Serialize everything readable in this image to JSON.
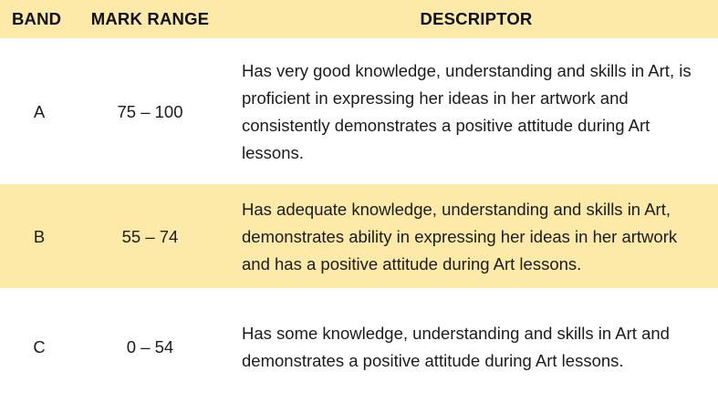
{
  "headers": {
    "band": "BAND",
    "range": "MARK RANGE",
    "descriptor": "DESCRIPTOR"
  },
  "rows": [
    {
      "band": "A",
      "range": "75 – 100",
      "descriptor": "Has very good knowledge, understanding and skills in Art, is proficient in expressing her ideas in her artwork and consistently demonstrates a positive attitude during Art lessons."
    },
    {
      "band": "B",
      "range": "55 – 74",
      "descriptor": "Has adequate knowledge, understanding and skills in Art, demonstrates ability in expressing her ideas in her artwork and has a positive attitude during Art lessons."
    },
    {
      "band": "C",
      "range": "0 – 54",
      "descriptor": "Has some knowledge, understanding and skills in Art and demonstrates a positive attitude during Art lessons."
    }
  ],
  "colors": {
    "header_bg": "#fde9a8",
    "alt_row_bg": "#fde9a8",
    "row_bg": "#ffffff",
    "text": "#1c1c1c"
  }
}
